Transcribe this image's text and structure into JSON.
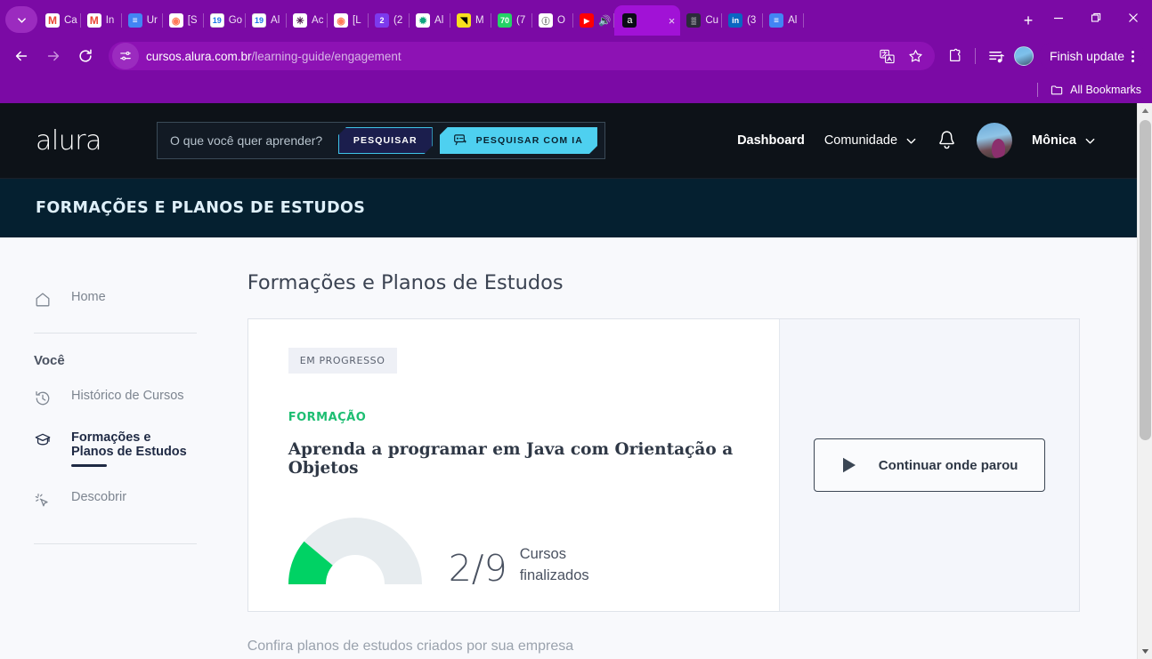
{
  "browser": {
    "tabs": [
      {
        "title": "Ca",
        "icon": "gmail-icon",
        "fav": "fav-gmail",
        "glyph": "M"
      },
      {
        "title": "In",
        "icon": "gmail-icon",
        "fav": "fav-gmail",
        "glyph": "M"
      },
      {
        "title": "Ur",
        "icon": "google-docs-icon",
        "fav": "fav-doc",
        "glyph": "≡"
      },
      {
        "title": "[S",
        "icon": "hubspot-icon",
        "fav": "fav-hub",
        "glyph": "◉"
      },
      {
        "title": "Go",
        "icon": "google-calendar-icon",
        "fav": "fav-cal",
        "glyph": "19"
      },
      {
        "title": "Al",
        "icon": "google-calendar-icon",
        "fav": "fav-cal",
        "glyph": "19"
      },
      {
        "title": "Ac",
        "icon": "slack-icon",
        "fav": "fav-slack",
        "glyph": "✳"
      },
      {
        "title": "[L",
        "icon": "hubspot-icon",
        "fav": "fav-hub",
        "glyph": "◉"
      },
      {
        "title": "(2",
        "icon": "notification-icon",
        "fav": "fav-purple",
        "glyph": "2"
      },
      {
        "title": "Al",
        "icon": "openai-icon",
        "fav": "fav-openai",
        "glyph": "✹"
      },
      {
        "title": "M",
        "icon": "javascript-icon",
        "fav": "fav-yellow",
        "glyph": "◥"
      },
      {
        "title": "(7",
        "icon": "whatsapp-icon",
        "fav": "fav-green",
        "glyph": "70"
      },
      {
        "title": "O",
        "icon": "generic-icon",
        "fav": "fav-white",
        "glyph": "Ⓘ"
      },
      {
        "title": "🔊",
        "icon": "youtube-icon",
        "fav": "fav-red",
        "glyph": "▶"
      },
      {
        "title": "",
        "icon": "alura-icon",
        "fav": "fav-alura",
        "glyph": "a",
        "active": true
      },
      {
        "title": "Cu",
        "icon": "qrcode-icon",
        "fav": "fav-dark",
        "glyph": "▒"
      },
      {
        "title": "(3",
        "icon": "linkedin-icon",
        "fav": "fav-li",
        "glyph": "in"
      },
      {
        "title": "Al",
        "icon": "google-docs-icon",
        "fav": "fav-doc",
        "glyph": "≡"
      }
    ],
    "new_tab_label": "+",
    "close_tab_label": "×",
    "window_minimize": "—",
    "window_restore": "❐",
    "window_close": "✕",
    "url_domain": "cursos.alura.com.br",
    "url_path": "/learning-guide/engagement",
    "finish_update_label": "Finish update",
    "all_bookmarks_label": "All Bookmarks"
  },
  "site": {
    "logo": "alura",
    "search_placeholder": "O que você quer aprender?",
    "search_button": "PESQUISAR",
    "search_ai_button": "PESQUISAR COM IA",
    "nav": {
      "dashboard": "Dashboard",
      "comunidade": "Comunidade",
      "user": "Mônica"
    },
    "subheader_title": "FORMAÇÕES E PLANOS DE ESTUDOS"
  },
  "sidebar": {
    "home": "Home",
    "section_title": "Você",
    "items": [
      {
        "label": "Histórico de Cursos",
        "icon": "history-icon"
      },
      {
        "label": "Formações e\nPlanos de Estudos",
        "icon": "graduation-cap-icon",
        "active": true
      },
      {
        "label": "Descobrir",
        "icon": "sparkle-cursor-icon"
      }
    ]
  },
  "main": {
    "page_title": "Formações e Planos de Estudos",
    "card": {
      "status_badge": "EM PROGRESSO",
      "type_tag": "FORMAÇÃO",
      "title": "Aprenda a programar em Java com Orientação a Objetos",
      "progress_fraction": "2/9",
      "progress_label_line1": "Cursos",
      "progress_label_line2": "finalizados",
      "completed": 2,
      "total": 9,
      "continue_button": "Continuar onde parou",
      "accent_green": "#00d264",
      "track_grey": "#e7ecef"
    },
    "below_text": "Confira planos de estudos criados por sua empresa"
  }
}
